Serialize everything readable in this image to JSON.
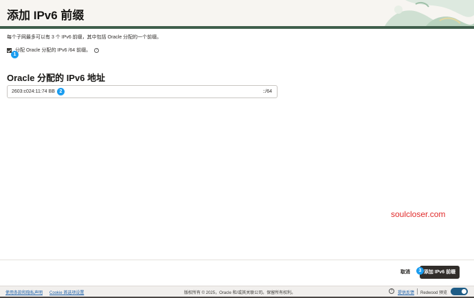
{
  "header": {
    "title": "添加 IPv6 前缀"
  },
  "description": "每个子网最多可以有 3 个 IPv6 前缀，其中包括 Oracle 分配的一个前缀。",
  "checkbox": {
    "label": "分配 Oracle 分配的 IPv6 /64 前缀。",
    "checked": true,
    "help_icon": "?"
  },
  "section": {
    "title": "Oracle 分配的 IPv6 地址"
  },
  "address_input": {
    "value": "2603:c024:11:74 BB",
    "suffix": "::/64"
  },
  "badges": {
    "one": "1",
    "two": "2",
    "three": "3"
  },
  "watermark": "soulcloser.com",
  "actions": {
    "cancel_label": "取消",
    "add_label": "添加 IPv6 前缀"
  },
  "footer": {
    "terms": "使用条款和隐私声明",
    "cookie": "Cookie 首选项设置",
    "copyright": "版权所有 © 2025，Oracle 和/或其关联公司。保留所有权利。",
    "help_icon": "?",
    "feedback": "提供反馈",
    "redwood": "Redwood 预览",
    "toggle_on": true
  },
  "colors": {
    "header_bar": "#3f5e4b",
    "badge": "#1a9df0",
    "primary_button": "#312d2a",
    "watermark": "#e02a2a",
    "toggle": "#1e5c86"
  }
}
